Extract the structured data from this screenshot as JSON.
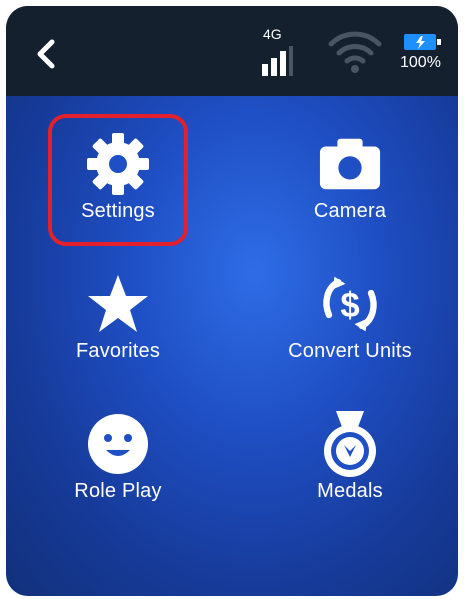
{
  "status": {
    "network": "4G",
    "battery_percent": "100%",
    "colors": {
      "bar_bg": "#14202e",
      "battery_fill": "#1e8fff"
    }
  },
  "nav": {
    "back_icon": "chevron-left-icon"
  },
  "menu": {
    "items": [
      {
        "label": "Settings",
        "icon": "gear-icon"
      },
      {
        "label": "Camera",
        "icon": "camera-icon"
      },
      {
        "label": "Favorites",
        "icon": "star-icon"
      },
      {
        "label": "Convert Units",
        "icon": "currency-exchange-icon"
      },
      {
        "label": "Role Play",
        "icon": "smiley-face-icon"
      },
      {
        "label": "Medals",
        "icon": "medal-icon"
      }
    ],
    "selected_index": 0,
    "selection_color": "#e3202c"
  }
}
